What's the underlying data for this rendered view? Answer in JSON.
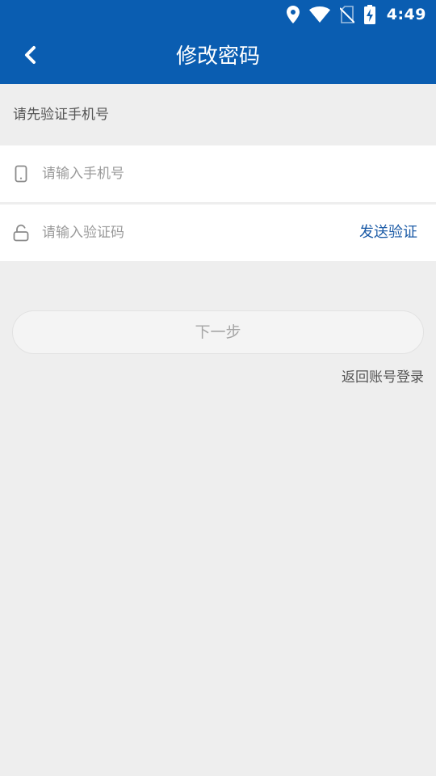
{
  "status_bar": {
    "time": "4:49",
    "icons": [
      "location-icon",
      "wifi-icon",
      "no-sim-icon",
      "battery-charging-icon"
    ]
  },
  "app_bar": {
    "back_icon": "chevron-left-icon",
    "title": "修改密码"
  },
  "form": {
    "hint": "请先验证手机号",
    "phone": {
      "icon": "phone-icon",
      "value": "",
      "placeholder": "请输入手机号"
    },
    "code": {
      "icon": "unlock-icon",
      "value": "",
      "placeholder": "请输入验证码",
      "send_label": "发送验证"
    },
    "next_label": "下一步",
    "return_login_label": "返回账号登录"
  },
  "colors": {
    "primary": "#0a5db1",
    "link": "#1a5aa6",
    "background": "#eeeeee",
    "button_text_disabled": "#a5a5a5"
  }
}
